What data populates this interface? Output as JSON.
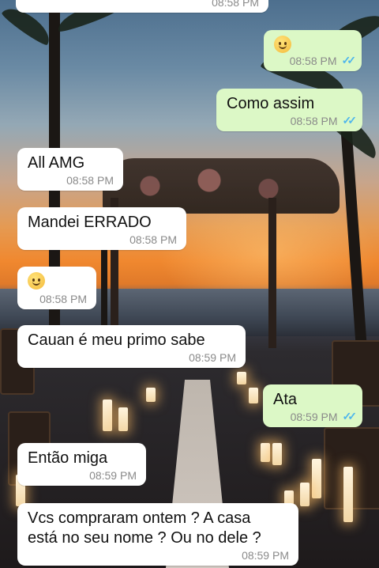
{
  "messages": [
    {
      "id": "m0",
      "dir": "in",
      "text": "",
      "time": "08:58 PM"
    },
    {
      "id": "m1",
      "dir": "out",
      "emoji": "thinking-face-emoji",
      "text": "",
      "time": "08:58 PM",
      "read": true
    },
    {
      "id": "m2",
      "dir": "out",
      "text": "Como assim",
      "time": "08:58 PM",
      "read": true
    },
    {
      "id": "m3",
      "dir": "in",
      "text": "All AMG",
      "time": "08:58 PM"
    },
    {
      "id": "m4",
      "dir": "in",
      "text": "Mandei ERRADO",
      "time": "08:58 PM"
    },
    {
      "id": "m5",
      "dir": "in",
      "emoji": "sweat-smile-emoji",
      "text": "",
      "time": "08:58 PM"
    },
    {
      "id": "m6",
      "dir": "in",
      "text": "Cauan é meu primo sabe",
      "time": "08:59 PM"
    },
    {
      "id": "m7",
      "dir": "out",
      "text": "Ata",
      "time": "08:59 PM",
      "read": true
    },
    {
      "id": "m8",
      "dir": "in",
      "text": "Então miga",
      "time": "08:59 PM"
    },
    {
      "id": "m9",
      "dir": "in",
      "text": "Vcs compraram ontem ? A casa\nestá no seu nome ? Ou no dele ?",
      "time": "08:59 PM"
    }
  ],
  "colors": {
    "incoming_bubble": "#ffffff",
    "outgoing_bubble": "#dcf8c6",
    "read_ticks": "#4fb6ec",
    "timestamp": "#8a8a8a"
  },
  "icons": {
    "read_receipt": "double-check-icon"
  }
}
